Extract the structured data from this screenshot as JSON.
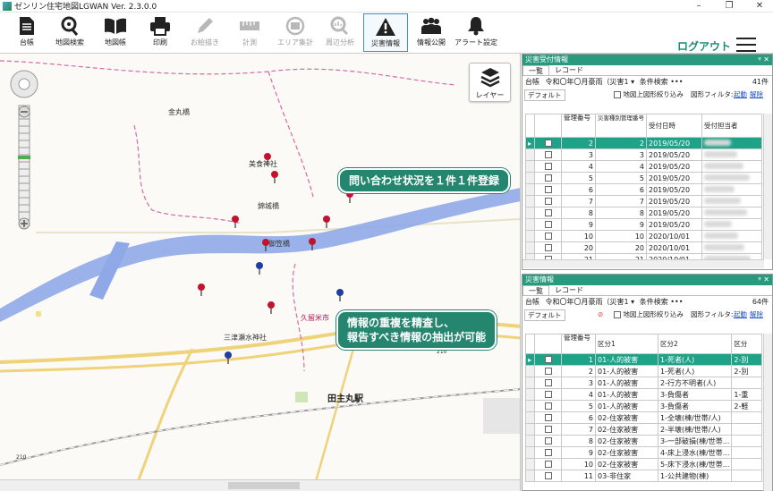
{
  "window": {
    "title": "ゼンリン住宅地図LGWAN Ver. 2.3.0.0",
    "min": "–",
    "max": "❐",
    "close": "✕"
  },
  "toolbar": {
    "items": [
      {
        "label": "台帳",
        "icon": "document-icon"
      },
      {
        "label": "地図検索",
        "icon": "map-search-icon"
      },
      {
        "label": "地図帳",
        "icon": "book-icon"
      },
      {
        "label": "印刷",
        "icon": "printer-icon"
      },
      {
        "label": "お絵描き",
        "icon": "pencil-icon"
      },
      {
        "label": "計測",
        "icon": "ruler-icon"
      },
      {
        "label": "エリア集計",
        "icon": "area-sum-icon"
      },
      {
        "label": "周辺分析",
        "icon": "analysis-icon"
      },
      {
        "label": "災害情報",
        "icon": "warning-icon"
      },
      {
        "label": "情報公開",
        "icon": "people-icon"
      },
      {
        "label": "アラート設定",
        "icon": "bell-icon"
      }
    ],
    "logout": "ログアウト"
  },
  "map": {
    "layer_label": "レイヤー",
    "places": {
      "kanamaru": "金丸橋",
      "shrine1": "美食神社",
      "bridge2": "錦城橋",
      "bridge3": "御笠橋",
      "city": "久留米市",
      "shrine2": "三津瀬水神社",
      "station": "田主丸駅",
      "route1": "210",
      "route2": "210"
    },
    "callouts": {
      "top": "問い合わせ状況を１件１件登録",
      "bottom_line1": "情報の重複を精査し、",
      "bottom_line2": "報告すべき情報の抽出が可能"
    }
  },
  "panel1": {
    "title": "災害受付情報",
    "tabs": [
      "一覧",
      "レコード"
    ],
    "filter_label": "台帳",
    "filter_value": "令和〇年〇月豪雨（災害1",
    "condition": "条件検索",
    "dots": "•••",
    "count": "41件",
    "default_btn": "デフォルト",
    "checkbox_label": "地図上図形絞り込み",
    "shape_filter": "図形フィルタ:",
    "link1": "起動",
    "link2": "解除",
    "columns": [
      "管理番号",
      "災害種別管理番号",
      "受付日時",
      "受付担当者"
    ],
    "rows": [
      {
        "a": "2",
        "b": "2",
        "date": "2019/05/20"
      },
      {
        "a": "3",
        "b": "3",
        "date": "2019/05/20"
      },
      {
        "a": "4",
        "b": "4",
        "date": "2019/05/20"
      },
      {
        "a": "5",
        "b": "5",
        "date": "2019/05/20"
      },
      {
        "a": "6",
        "b": "6",
        "date": "2019/05/20"
      },
      {
        "a": "7",
        "b": "7",
        "date": "2019/05/20"
      },
      {
        "a": "8",
        "b": "8",
        "date": "2019/05/20"
      },
      {
        "a": "9",
        "b": "9",
        "date": "2019/05/20"
      },
      {
        "a": "10",
        "b": "10",
        "date": "2020/10/01"
      },
      {
        "a": "20",
        "b": "20",
        "date": "2020/10/01"
      },
      {
        "a": "21",
        "b": "21",
        "date": "2020/10/01"
      }
    ]
  },
  "panel2": {
    "title": "災害情報",
    "tabs": [
      "一覧",
      "レコード"
    ],
    "filter_label": "台帳",
    "filter_value": "令和〇年〇月豪雨（災害1",
    "condition": "条件検索",
    "dots": "•••",
    "count": "64件",
    "default_btn": "デフォルト",
    "checkbox_label": "地図上図形絞り込み",
    "shape_filter": "図形フィルタ:",
    "link1": "起動",
    "link2": "解除",
    "columns": [
      "管理番号",
      "区分1",
      "区分2",
      "区分"
    ],
    "rows": [
      {
        "a": "1",
        "k1": "01-人的被害",
        "k2": "1-死者(人)",
        "k3": "2-別"
      },
      {
        "a": "2",
        "k1": "01-人的被害",
        "k2": "1-死者(人)",
        "k3": "2-別"
      },
      {
        "a": "3",
        "k1": "01-人的被害",
        "k2": "2-行方不明者(人)",
        "k3": ""
      },
      {
        "a": "4",
        "k1": "01-人的被害",
        "k2": "3-負傷者",
        "k3": "1-重"
      },
      {
        "a": "5",
        "k1": "01-人的被害",
        "k2": "3-負傷者",
        "k3": "2-軽"
      },
      {
        "a": "6",
        "k1": "02-住家被害",
        "k2": "1-全壊(棟/世帯/人)",
        "k3": ""
      },
      {
        "a": "7",
        "k1": "02-住家被害",
        "k2": "2-半壊(棟/世帯/人)",
        "k3": ""
      },
      {
        "a": "8",
        "k1": "02-住家被害",
        "k2": "3-一部破損(棟/世帯...",
        "k3": ""
      },
      {
        "a": "9",
        "k1": "02-住家被害",
        "k2": "4-床上浸水(棟/世帯...",
        "k3": ""
      },
      {
        "a": "10",
        "k1": "02-住家被害",
        "k2": "5-床下浸水(棟/世帯...",
        "k3": ""
      },
      {
        "a": "11",
        "k1": "03-非住家",
        "k2": "1-公共建物(棟)",
        "k3": ""
      }
    ]
  }
}
